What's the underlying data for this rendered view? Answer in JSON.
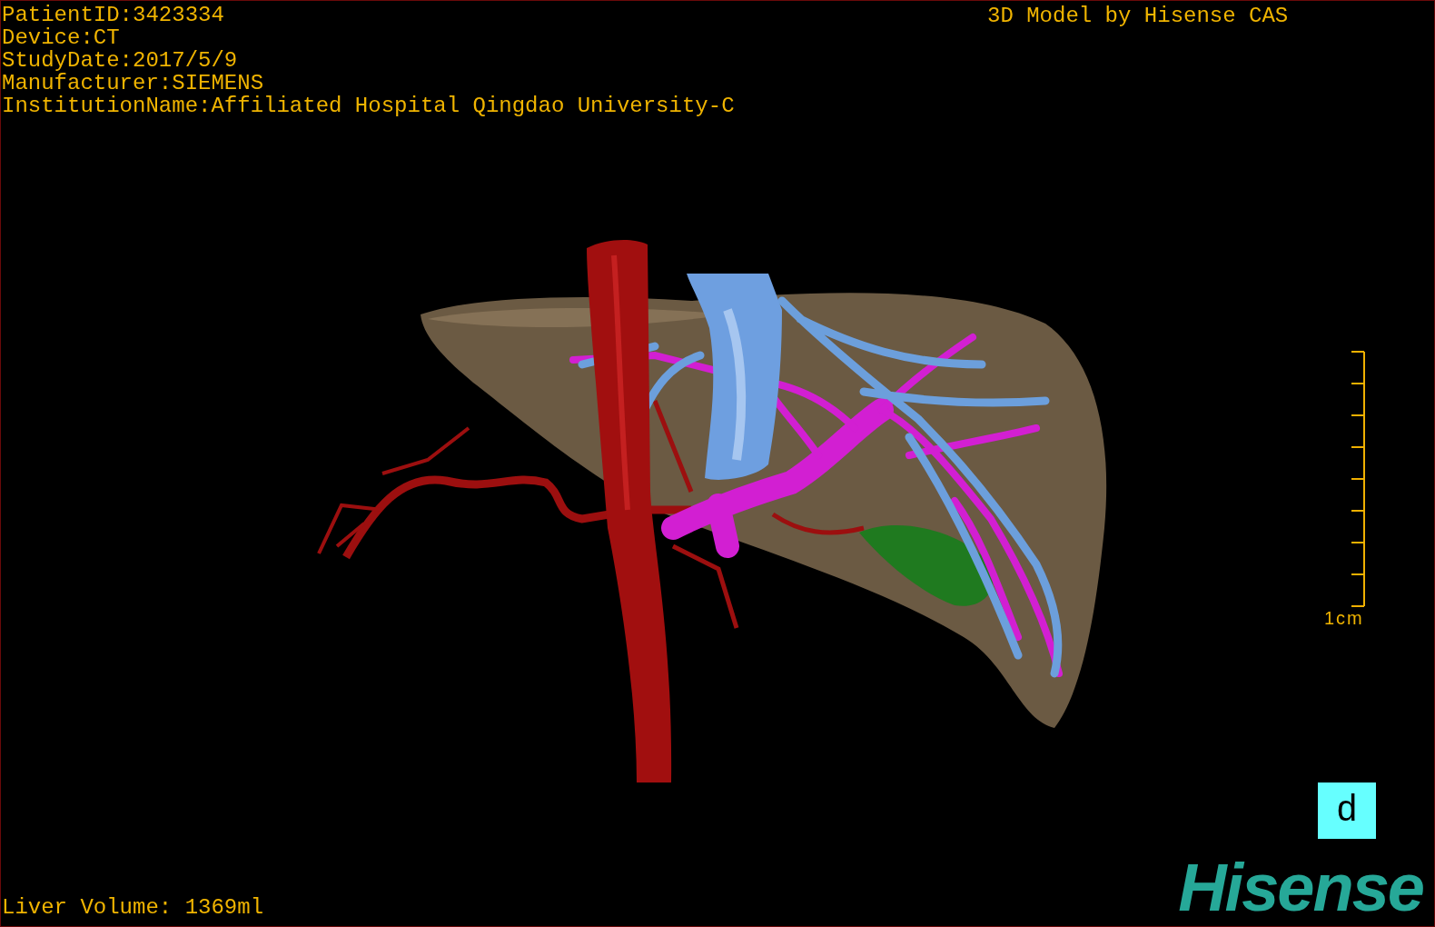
{
  "study_info": [
    "PatientID:3423334",
    "Device:CT",
    "StudyDate:2017/5/9",
    "Manufacturer:SIEMENS",
    "InstitutionName:Affiliated Hospital Qingdao University-C"
  ],
  "title": "3D Model by Hisense CAS",
  "scale_bar": {
    "label": "1cm"
  },
  "liver_volume": "Liver Volume: 1369ml",
  "view_button": {
    "label": "d"
  },
  "logo": "Hisense"
}
